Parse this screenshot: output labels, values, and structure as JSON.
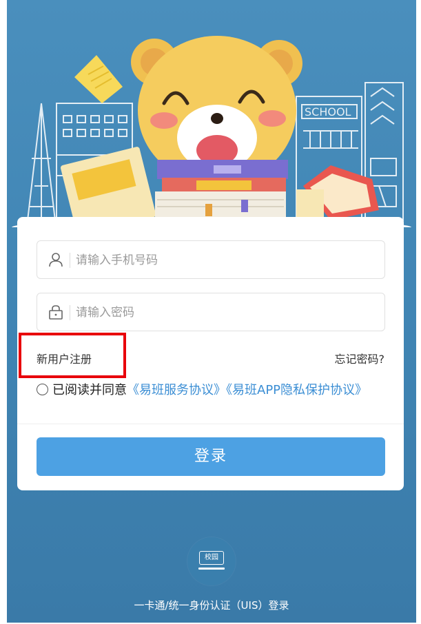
{
  "hero": {
    "school_sign": "SCHOOL"
  },
  "login_form": {
    "phone": {
      "placeholder": "请输入手机号码",
      "value": ""
    },
    "password": {
      "placeholder": "请输入密码",
      "value": ""
    },
    "register_label": "新用户注册",
    "forgot_label": "忘记密码?",
    "agreement": {
      "checked": false,
      "prefix": "已阅读并同意",
      "service_link": "《易班服务协议》",
      "privacy_link": "《易班APP隐私保护协议》"
    },
    "login_label": "登录"
  },
  "footer": {
    "campus_badge": "校园",
    "uis_login_label": "一卡通/统一身份认证（UIS）登录"
  },
  "colors": {
    "background": "#4a8fbd",
    "primary_button": "#4da1e3",
    "link": "#3b8ed4",
    "highlight_box": "#e8000b"
  },
  "icons": [
    "user-icon",
    "lock-icon",
    "campus-icon"
  ]
}
